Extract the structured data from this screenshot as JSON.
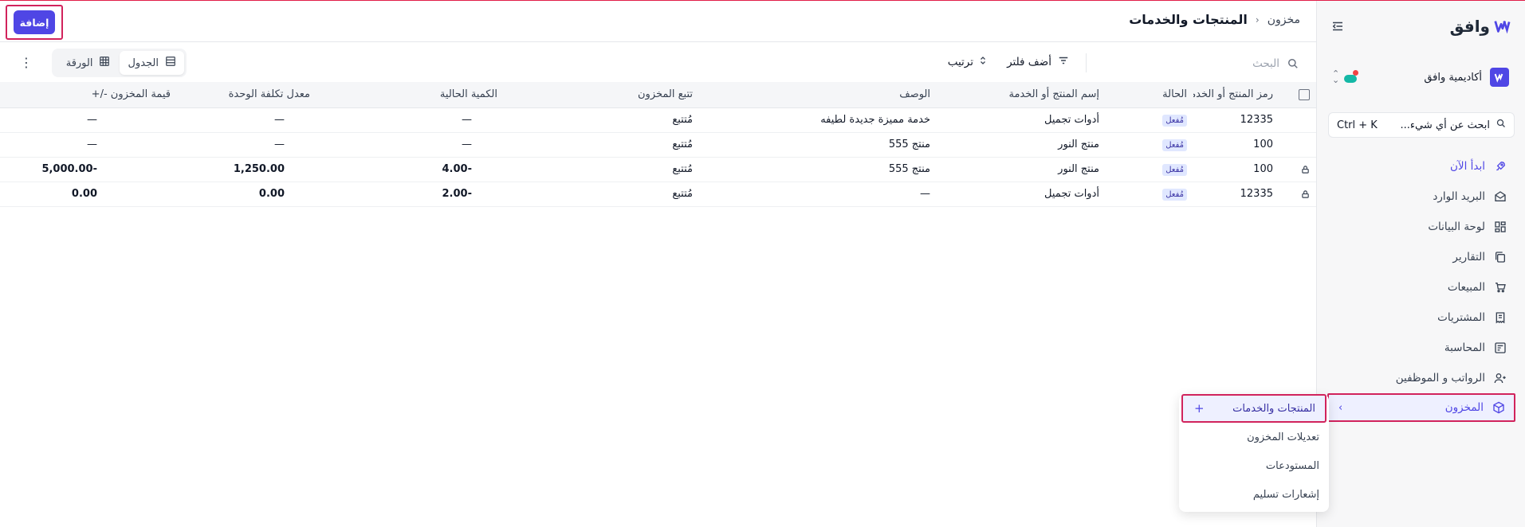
{
  "app": {
    "logo_text": "وافق",
    "org_name": "أكاديمية وافق"
  },
  "sidebar": {
    "search": {
      "label": "ابحث عن أي شيء...",
      "shortcut": "Ctrl + K"
    },
    "items": [
      {
        "label": "ابدأ الآن",
        "icon": "rocket-icon"
      },
      {
        "label": "البريد الوارد",
        "icon": "inbox-icon"
      },
      {
        "label": "لوحة البيانات",
        "icon": "dashboard-icon"
      },
      {
        "label": "التقارير",
        "icon": "reports-icon"
      },
      {
        "label": "المبيعات",
        "icon": "cart-icon"
      },
      {
        "label": "المشتريات",
        "icon": "receipt-icon"
      },
      {
        "label": "المحاسبة",
        "icon": "ledger-icon"
      },
      {
        "label": "الرواتب و الموظفين",
        "icon": "users-icon"
      },
      {
        "label": "المخزون",
        "icon": "box-icon"
      }
    ]
  },
  "flyout": {
    "items": [
      {
        "label": "المنتجات والخدمات"
      },
      {
        "label": "تعديلات المخزون"
      },
      {
        "label": "المستودعات"
      },
      {
        "label": "إشعارات تسليم"
      }
    ],
    "add_symbol": "+"
  },
  "header": {
    "breadcrumb_parent": "مخزون",
    "title": "المنتجات والخدمات",
    "add_button": "إضافة"
  },
  "toolbar": {
    "search_placeholder": "البحث",
    "filter_label": "أضف فلتر",
    "sort_label": "ترتيب",
    "view_table": "الجدول",
    "view_sheet": "الورقة"
  },
  "table": {
    "columns": [
      "رمز المنتج أو الخدمة",
      "الحالة",
      "إسم المنتج أو الخدمة",
      "الوصف",
      "تتبع المخزون",
      "الكمية الحالية",
      "معدل تكلفة الوحدة",
      "قيمة المخزون -/+"
    ],
    "rows": [
      {
        "locked": false,
        "code": "12335",
        "status": "مُفعل",
        "name": "أدوات تجميل",
        "description": "خدمة مميزة جديدة لطيفه",
        "tracking": "مُتتبع",
        "qty": "—",
        "unit_cost": "—",
        "value": "—"
      },
      {
        "locked": false,
        "code": "100",
        "status": "مُفعل",
        "name": "منتج النور",
        "description": "منتج 555",
        "tracking": "مُتتبع",
        "qty": "—",
        "unit_cost": "—",
        "value": "—"
      },
      {
        "locked": true,
        "code": "100",
        "status": "مُفعل",
        "name": "منتج النور",
        "description": "منتج 555",
        "tracking": "مُتتبع",
        "qty": "-4.00",
        "unit_cost": "1,250.00",
        "value": "-5,000.00"
      },
      {
        "locked": true,
        "code": "12335",
        "status": "مُفعل",
        "name": "أدوات تجميل",
        "description": "—",
        "tracking": "مُتتبع",
        "qty": "-2.00",
        "unit_cost": "0.00",
        "value": "0.00"
      }
    ]
  },
  "colors": {
    "accent": "#4f46e5",
    "highlight_border": "#d1235c",
    "badge_bg": "#e0e7ff"
  }
}
